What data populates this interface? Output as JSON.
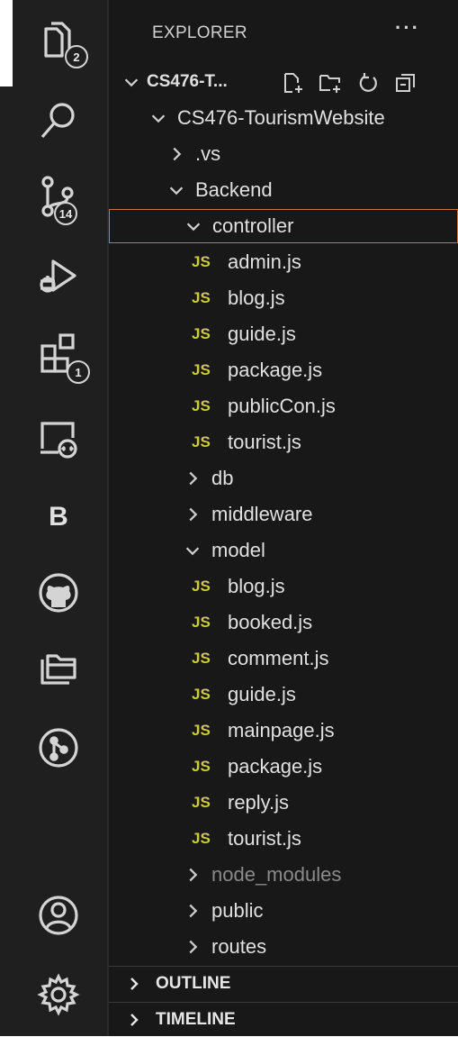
{
  "activity_bar": {
    "explorer_badge": "2",
    "source_control_badge": "14",
    "extensions_badge": "1",
    "bootstrap_letter": "B"
  },
  "explorer": {
    "title": "EXPLORER",
    "more_label": "···",
    "workspace_label": "CS476-T...",
    "root_folder": "CS476-TourismWebsite",
    "tree": [
      {
        "label": ".vs",
        "type": "folder",
        "expanded": false
      },
      {
        "label": "Backend",
        "type": "folder",
        "expanded": true
      },
      {
        "label": "controller",
        "type": "folder",
        "expanded": true,
        "selected": true
      },
      {
        "label": "admin.js",
        "type": "js"
      },
      {
        "label": "blog.js",
        "type": "js"
      },
      {
        "label": "guide.js",
        "type": "js"
      },
      {
        "label": "package.js",
        "type": "js"
      },
      {
        "label": "publicCon.js",
        "type": "js"
      },
      {
        "label": "tourist.js",
        "type": "js"
      },
      {
        "label": "db",
        "type": "folder",
        "expanded": false
      },
      {
        "label": "middleware",
        "type": "folder",
        "expanded": false
      },
      {
        "label": "model",
        "type": "folder",
        "expanded": true
      },
      {
        "label": "blog.js",
        "type": "js"
      },
      {
        "label": "booked.js",
        "type": "js"
      },
      {
        "label": "comment.js",
        "type": "js"
      },
      {
        "label": "guide.js",
        "type": "js"
      },
      {
        "label": "mainpage.js",
        "type": "js"
      },
      {
        "label": "package.js",
        "type": "js"
      },
      {
        "label": "reply.js",
        "type": "js"
      },
      {
        "label": "tourist.js",
        "type": "js"
      },
      {
        "label": "node_modules",
        "type": "folder",
        "expanded": false,
        "muted": true
      },
      {
        "label": "public",
        "type": "folder",
        "expanded": false
      },
      {
        "label": "routes",
        "type": "folder",
        "expanded": false
      }
    ],
    "js_badge": "JS",
    "outline_label": "OUTLINE",
    "timeline_label": "TIMELINE"
  },
  "colors": {
    "js_badge": "#cbcb41",
    "selection_border": "#c8753f",
    "sidebar_bg": "#181818",
    "activity_bg": "#1f1f1f"
  }
}
